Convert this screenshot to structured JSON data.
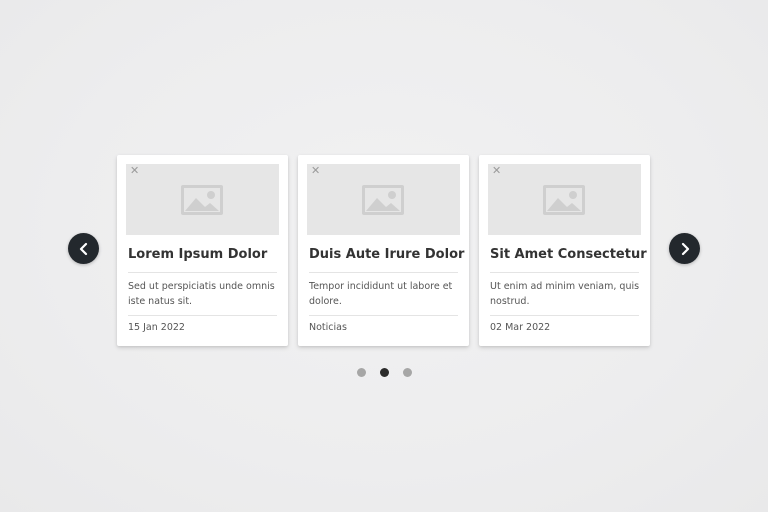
{
  "carousel": {
    "cards": [
      {
        "title": "Lorem Ipsum Dolor",
        "description": "Sed ut perspiciatis unde omnis iste natus sit.",
        "meta": "15 Jan 2022",
        "image_icon": "image-placeholder-icon",
        "close_icon": "close-icon"
      },
      {
        "title": "Duis Aute Irure Dolor",
        "description": "Tempor incididunt ut labore et dolore.",
        "meta": "Noticias",
        "image_icon": "image-placeholder-icon",
        "close_icon": "close-icon"
      },
      {
        "title": "Sit Amet Consectetur",
        "description": "Ut enim ad minim veniam, quis nostrud.",
        "meta": "02 Mar 2022",
        "image_icon": "image-placeholder-icon",
        "close_icon": "close-icon"
      }
    ],
    "prev_icon": "chevron-left-icon",
    "next_icon": "chevron-right-icon",
    "pagination": {
      "total": 3,
      "active_index": 1
    },
    "colors": {
      "background": "#eeeeef",
      "nav_button": "#23282d",
      "dot_active": "#2b2b2b",
      "dot_inactive": "#a6a6a6",
      "placeholder": "#e6e6e6"
    }
  }
}
